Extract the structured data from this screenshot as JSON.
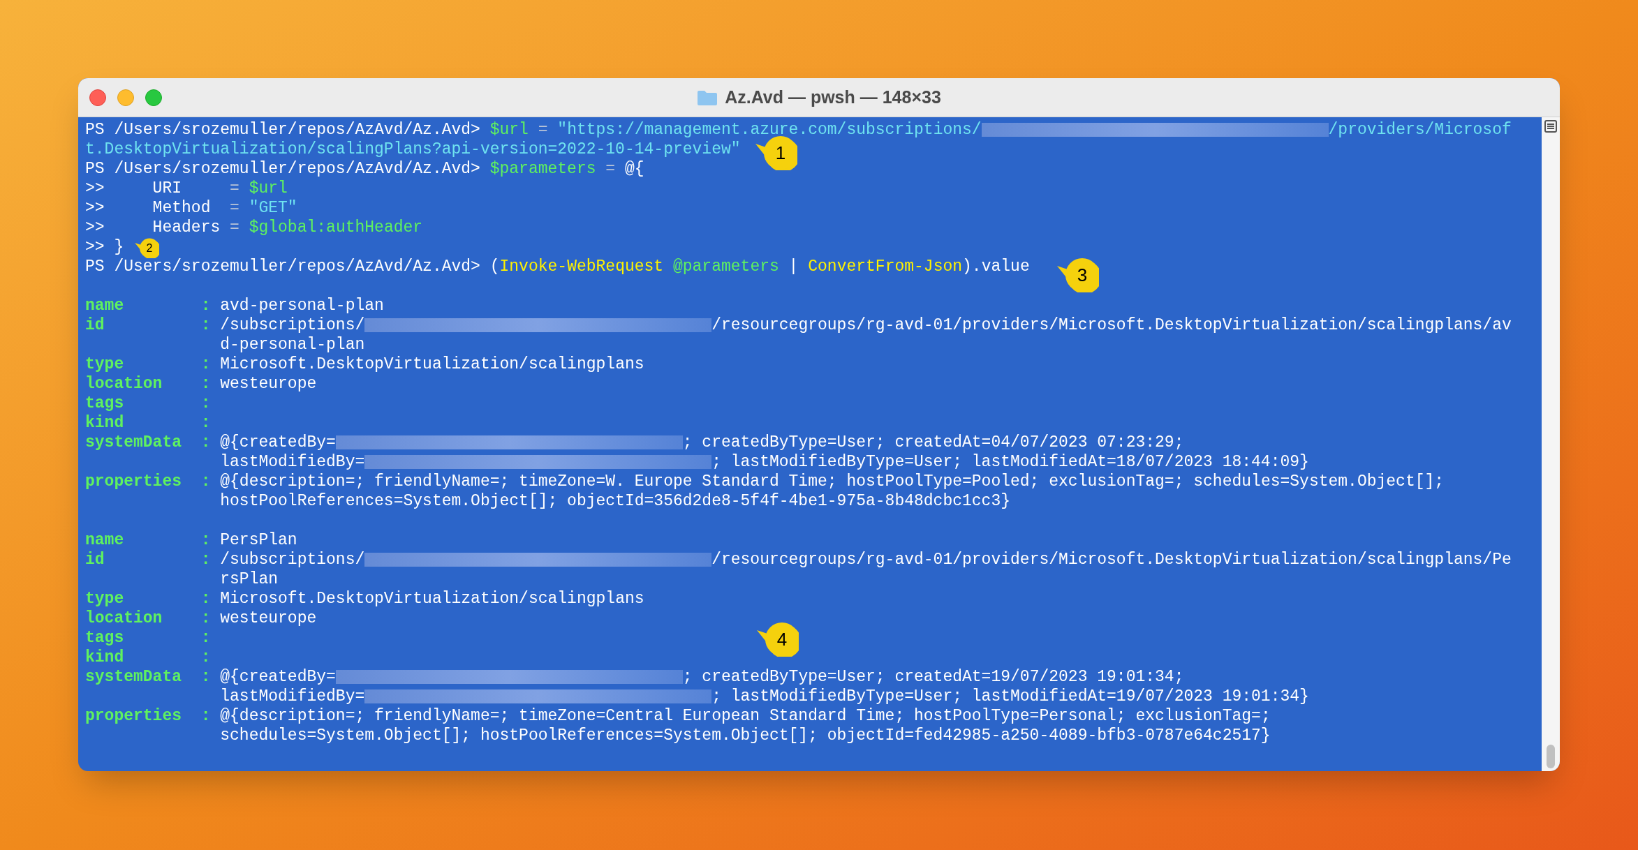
{
  "window": {
    "title": "Az.Avd — pwsh — 148×33"
  },
  "terminal": {
    "lines": [
      {
        "kind": "text",
        "segments": [
          {
            "kind": "prompt",
            "text": "PS /Users/srozemuller/repos/AzAvd/Az.Avd> "
          },
          {
            "kind": "variable",
            "text": "$url"
          },
          {
            "kind": "operator",
            "text": " = "
          },
          {
            "kind": "string",
            "text": "\"https://management.azure.com/subscriptions/"
          },
          {
            "kind": "redacted"
          },
          {
            "kind": "string",
            "text": "/providers/Microsof"
          }
        ]
      },
      {
        "kind": "text",
        "segments": [
          {
            "kind": "string",
            "text": "t.DesktopVirtualization/scalingPlans?api-version=2022-10-14-preview\""
          }
        ]
      },
      {
        "kind": "text",
        "segments": [
          {
            "kind": "prompt",
            "text": "PS /Users/srozemuller/repos/AzAvd/Az.Avd> "
          },
          {
            "kind": "variable",
            "text": "$parameters"
          },
          {
            "kind": "operator",
            "text": " = "
          },
          {
            "kind": "plain",
            "text": "@{"
          }
        ]
      },
      {
        "kind": "text",
        "segments": [
          {
            "kind": "plain",
            "text": ">>     URI     "
          },
          {
            "kind": "operator",
            "text": "= "
          },
          {
            "kind": "variable",
            "text": "$url"
          }
        ]
      },
      {
        "kind": "text",
        "segments": [
          {
            "kind": "plain",
            "text": ">>     Method  "
          },
          {
            "kind": "operator",
            "text": "= "
          },
          {
            "kind": "string",
            "text": "\"GET\""
          }
        ]
      },
      {
        "kind": "text",
        "segments": [
          {
            "kind": "plain",
            "text": ">>     Headers "
          },
          {
            "kind": "operator",
            "text": "= "
          },
          {
            "kind": "variable",
            "text": "$global:authHeader"
          }
        ]
      },
      {
        "kind": "text",
        "segments": [
          {
            "kind": "plain",
            "text": ">> }"
          }
        ]
      },
      {
        "kind": "text",
        "segments": [
          {
            "kind": "prompt",
            "text": "PS /Users/srozemuller/repos/AzAvd/Az.Avd> "
          },
          {
            "kind": "plain",
            "text": "("
          },
          {
            "kind": "command",
            "text": "Invoke-WebRequest"
          },
          {
            "kind": "variable",
            "text": " @parameters"
          },
          {
            "kind": "plain",
            "text": " | "
          },
          {
            "kind": "command",
            "text": "ConvertFrom-Json"
          },
          {
            "kind": "plain",
            "text": ").value"
          }
        ]
      },
      {
        "kind": "blank"
      },
      {
        "kind": "text",
        "segments": [
          {
            "kind": "key",
            "text": "name        : "
          },
          {
            "kind": "plain",
            "text": "avd-personal-plan"
          }
        ]
      },
      {
        "kind": "text",
        "segments": [
          {
            "kind": "key",
            "text": "id          : "
          },
          {
            "kind": "plain",
            "text": "/subscriptions/"
          },
          {
            "kind": "redacted"
          },
          {
            "kind": "plain",
            "text": "/resourcegroups/rg-avd-01/providers/Microsoft.DesktopVirtualization/scalingplans/av"
          }
        ]
      },
      {
        "kind": "text",
        "segments": [
          {
            "kind": "plain",
            "text": "              d-personal-plan"
          }
        ]
      },
      {
        "kind": "text",
        "segments": [
          {
            "kind": "key",
            "text": "type        : "
          },
          {
            "kind": "plain",
            "text": "Microsoft.DesktopVirtualization/scalingplans"
          }
        ]
      },
      {
        "kind": "text",
        "segments": [
          {
            "kind": "key",
            "text": "location    : "
          },
          {
            "kind": "plain",
            "text": "westeurope"
          }
        ]
      },
      {
        "kind": "text",
        "segments": [
          {
            "kind": "key",
            "text": "tags        :"
          }
        ]
      },
      {
        "kind": "text",
        "segments": [
          {
            "kind": "key",
            "text": "kind        :"
          }
        ]
      },
      {
        "kind": "text",
        "segments": [
          {
            "kind": "key",
            "text": "systemData  : "
          },
          {
            "kind": "plain",
            "text": "@{createdBy="
          },
          {
            "kind": "redacted"
          },
          {
            "kind": "plain",
            "text": "; createdByType=User; createdAt=04/07/2023 07:23:29;"
          }
        ]
      },
      {
        "kind": "text",
        "segments": [
          {
            "kind": "plain",
            "text": "              lastModifiedBy="
          },
          {
            "kind": "redacted"
          },
          {
            "kind": "plain",
            "text": "; lastModifiedByType=User; lastModifiedAt=18/07/2023 18:44:09}"
          }
        ]
      },
      {
        "kind": "text",
        "segments": [
          {
            "kind": "key",
            "text": "properties  : "
          },
          {
            "kind": "plain",
            "text": "@{description=; friendlyName=; timeZone=W. Europe Standard Time; hostPoolType=Pooled; exclusionTag=; schedules=System.Object[];"
          }
        ]
      },
      {
        "kind": "text",
        "segments": [
          {
            "kind": "plain",
            "text": "              hostPoolReferences=System.Object[]; objectId=356d2de8-5f4f-4be1-975a-8b48dcbc1cc3}"
          }
        ]
      },
      {
        "kind": "blank"
      },
      {
        "kind": "text",
        "segments": [
          {
            "kind": "key",
            "text": "name        : "
          },
          {
            "kind": "plain",
            "text": "PersPlan"
          }
        ]
      },
      {
        "kind": "text",
        "segments": [
          {
            "kind": "key",
            "text": "id          : "
          },
          {
            "kind": "plain",
            "text": "/subscriptions/"
          },
          {
            "kind": "redacted"
          },
          {
            "kind": "plain",
            "text": "/resourcegroups/rg-avd-01/providers/Microsoft.DesktopVirtualization/scalingplans/Pe"
          }
        ]
      },
      {
        "kind": "text",
        "segments": [
          {
            "kind": "plain",
            "text": "              rsPlan"
          }
        ]
      },
      {
        "kind": "text",
        "segments": [
          {
            "kind": "key",
            "text": "type        : "
          },
          {
            "kind": "plain",
            "text": "Microsoft.DesktopVirtualization/scalingplans"
          }
        ]
      },
      {
        "kind": "text",
        "segments": [
          {
            "kind": "key",
            "text": "location    : "
          },
          {
            "kind": "plain",
            "text": "westeurope"
          }
        ]
      },
      {
        "kind": "text",
        "segments": [
          {
            "kind": "key",
            "text": "tags        :"
          }
        ]
      },
      {
        "kind": "text",
        "segments": [
          {
            "kind": "key",
            "text": "kind        :"
          }
        ]
      },
      {
        "kind": "text",
        "segments": [
          {
            "kind": "key",
            "text": "systemData  : "
          },
          {
            "kind": "plain",
            "text": "@{createdBy="
          },
          {
            "kind": "redacted"
          },
          {
            "kind": "plain",
            "text": "; createdByType=User; createdAt=19/07/2023 19:01:34;"
          }
        ]
      },
      {
        "kind": "text",
        "segments": [
          {
            "kind": "plain",
            "text": "              lastModifiedBy="
          },
          {
            "kind": "redacted"
          },
          {
            "kind": "plain",
            "text": "; lastModifiedByType=User; lastModifiedAt=19/07/2023 19:01:34}"
          }
        ]
      },
      {
        "kind": "text",
        "segments": [
          {
            "kind": "key",
            "text": "properties  : "
          },
          {
            "kind": "plain",
            "text": "@{description=; friendlyName=; timeZone=Central European Standard Time; hostPoolType=Personal; exclusionTag=;"
          }
        ]
      },
      {
        "kind": "text",
        "segments": [
          {
            "kind": "plain",
            "text": "              schedules=System.Object[]; hostPoolReferences=System.Object[]; objectId=fed42985-a250-4089-bfb3-0787e64c2517}"
          }
        ]
      }
    ]
  },
  "callouts": [
    {
      "label": "1"
    },
    {
      "label": "2"
    },
    {
      "label": "3"
    },
    {
      "label": "4"
    }
  ]
}
